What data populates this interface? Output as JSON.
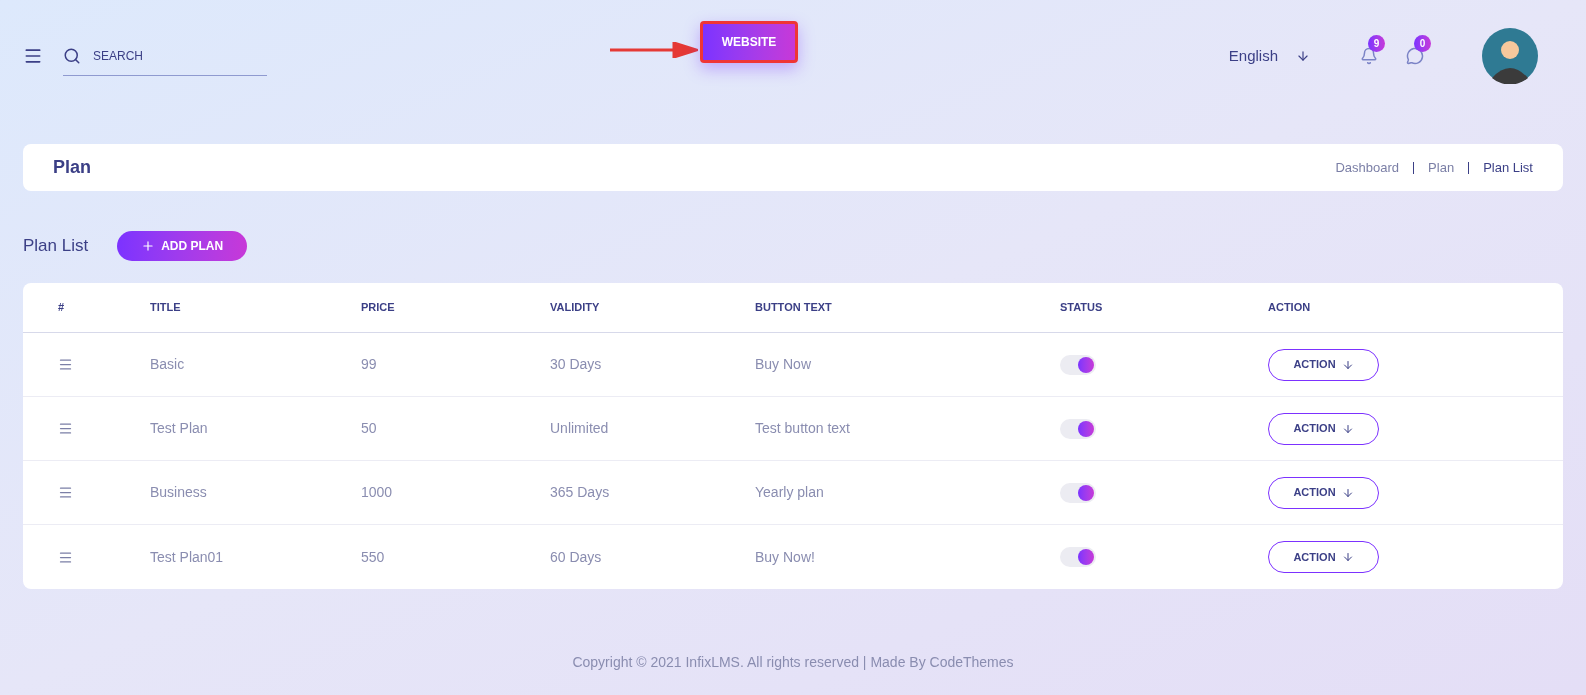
{
  "header": {
    "search": {
      "placeholder": "SEARCH"
    },
    "website_button": "WEBSITE",
    "language": "English",
    "notifications": "9",
    "messages": "0"
  },
  "page_title": {
    "title": "Plan",
    "breadcrumbs": [
      "Dashboard",
      "Plan",
      "Plan List"
    ]
  },
  "list": {
    "title": "Plan List",
    "add_button": "ADD PLAN"
  },
  "table": {
    "columns": [
      "#",
      "TITLE",
      "PRICE",
      "VALIDITY",
      "BUTTON TEXT",
      "STATUS",
      "ACTION"
    ],
    "rows": [
      {
        "title": "Basic",
        "price": "99",
        "validity": "30 Days",
        "button_text": "Buy Now",
        "status_on": true,
        "action": "ACTION"
      },
      {
        "title": "Test Plan",
        "price": "50",
        "validity": "Unlimited",
        "button_text": "Test button text",
        "status_on": true,
        "action": "ACTION"
      },
      {
        "title": "Business",
        "price": "1000",
        "validity": "365 Days",
        "button_text": "Yearly plan",
        "status_on": true,
        "action": "ACTION"
      },
      {
        "title": "Test Plan01",
        "price": "550",
        "validity": "60 Days",
        "button_text": "Buy Now!",
        "status_on": true,
        "action": "ACTION"
      }
    ]
  },
  "footer": "Copyright © 2021 InfixLMS. All rights reserved | Made By CodeThemes"
}
